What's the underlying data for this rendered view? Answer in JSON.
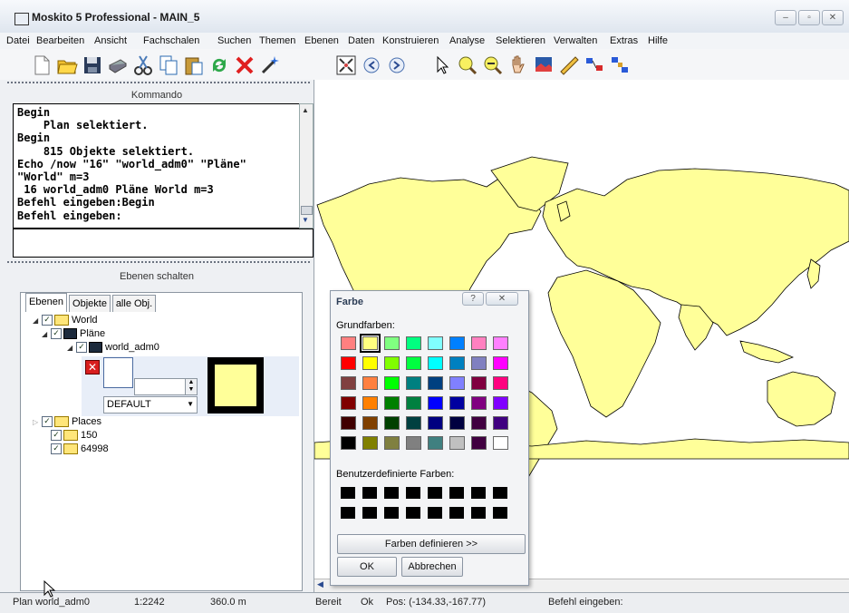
{
  "window": {
    "title": "Moskito 5 Professional - MAIN_5"
  },
  "menu": [
    "Datei",
    "Bearbeiten",
    "Ansicht",
    "Fachschalen",
    "Suchen",
    "Themen",
    "Ebenen",
    "Daten",
    "Konstruieren",
    "Analyse",
    "Selektieren",
    "Verwalten",
    "Extras",
    "Hilfe"
  ],
  "command_panel": {
    "title": "Kommando",
    "lines": "Begin\n    Plan selektiert.\nBegin\n    815 Objekte selektiert.\nEcho /now \"16\" \"world_adm0\" \"Pläne\"\n\"World\" m=3\n 16 world_adm0 Pläne World m=3\nBefehl eingeben:Begin\nBefehl eingeben:"
  },
  "layers_panel": {
    "title": "Ebenen schalten",
    "tabs": [
      "Ebenen",
      "Objekte",
      "alle Obj."
    ],
    "tree": {
      "world": "World",
      "plaene": "Pläne",
      "world_adm0": "world_adm0",
      "places": "Places",
      "n150": "150",
      "n64998": "64998"
    },
    "style_select": "DEFAULT",
    "swatch_color": "#ffff99"
  },
  "color_dialog": {
    "title": "Farbe",
    "basic_label": "Grundfarben:",
    "custom_label": "Benutzerdefinierte Farben:",
    "define_button": "Farben definieren >>",
    "ok_button": "OK",
    "cancel_button": "Abbrechen",
    "basic_colors": [
      "#ff8080",
      "#ffff80",
      "#80ff80",
      "#00ff80",
      "#80ffff",
      "#0080ff",
      "#ff80c0",
      "#ff80ff",
      "#ff0000",
      "#ffff00",
      "#80ff00",
      "#00ff40",
      "#00ffff",
      "#0080c0",
      "#8080c0",
      "#ff00ff",
      "#804040",
      "#ff8040",
      "#00ff00",
      "#008080",
      "#004080",
      "#8080ff",
      "#800040",
      "#ff0080",
      "#800000",
      "#ff8000",
      "#008000",
      "#008040",
      "#0000ff",
      "#0000a0",
      "#800080",
      "#8000ff",
      "#400000",
      "#804000",
      "#004000",
      "#004040",
      "#000080",
      "#000040",
      "#400040",
      "#400080",
      "#000000",
      "#808000",
      "#808040",
      "#808080",
      "#408080",
      "#c0c0c0",
      "#400040",
      "#ffffff"
    ],
    "selected_color": "#ffff80"
  },
  "map": {
    "land_color": "#ffff99"
  },
  "status": {
    "plan": "Plan world_adm0",
    "scale": "1:2242",
    "distance": "360.0 m",
    "state": "Bereit",
    "ok": "Ok",
    "pos": "Pos: (-134.33,-167.77)",
    "prompt": "Befehl eingeben:"
  }
}
